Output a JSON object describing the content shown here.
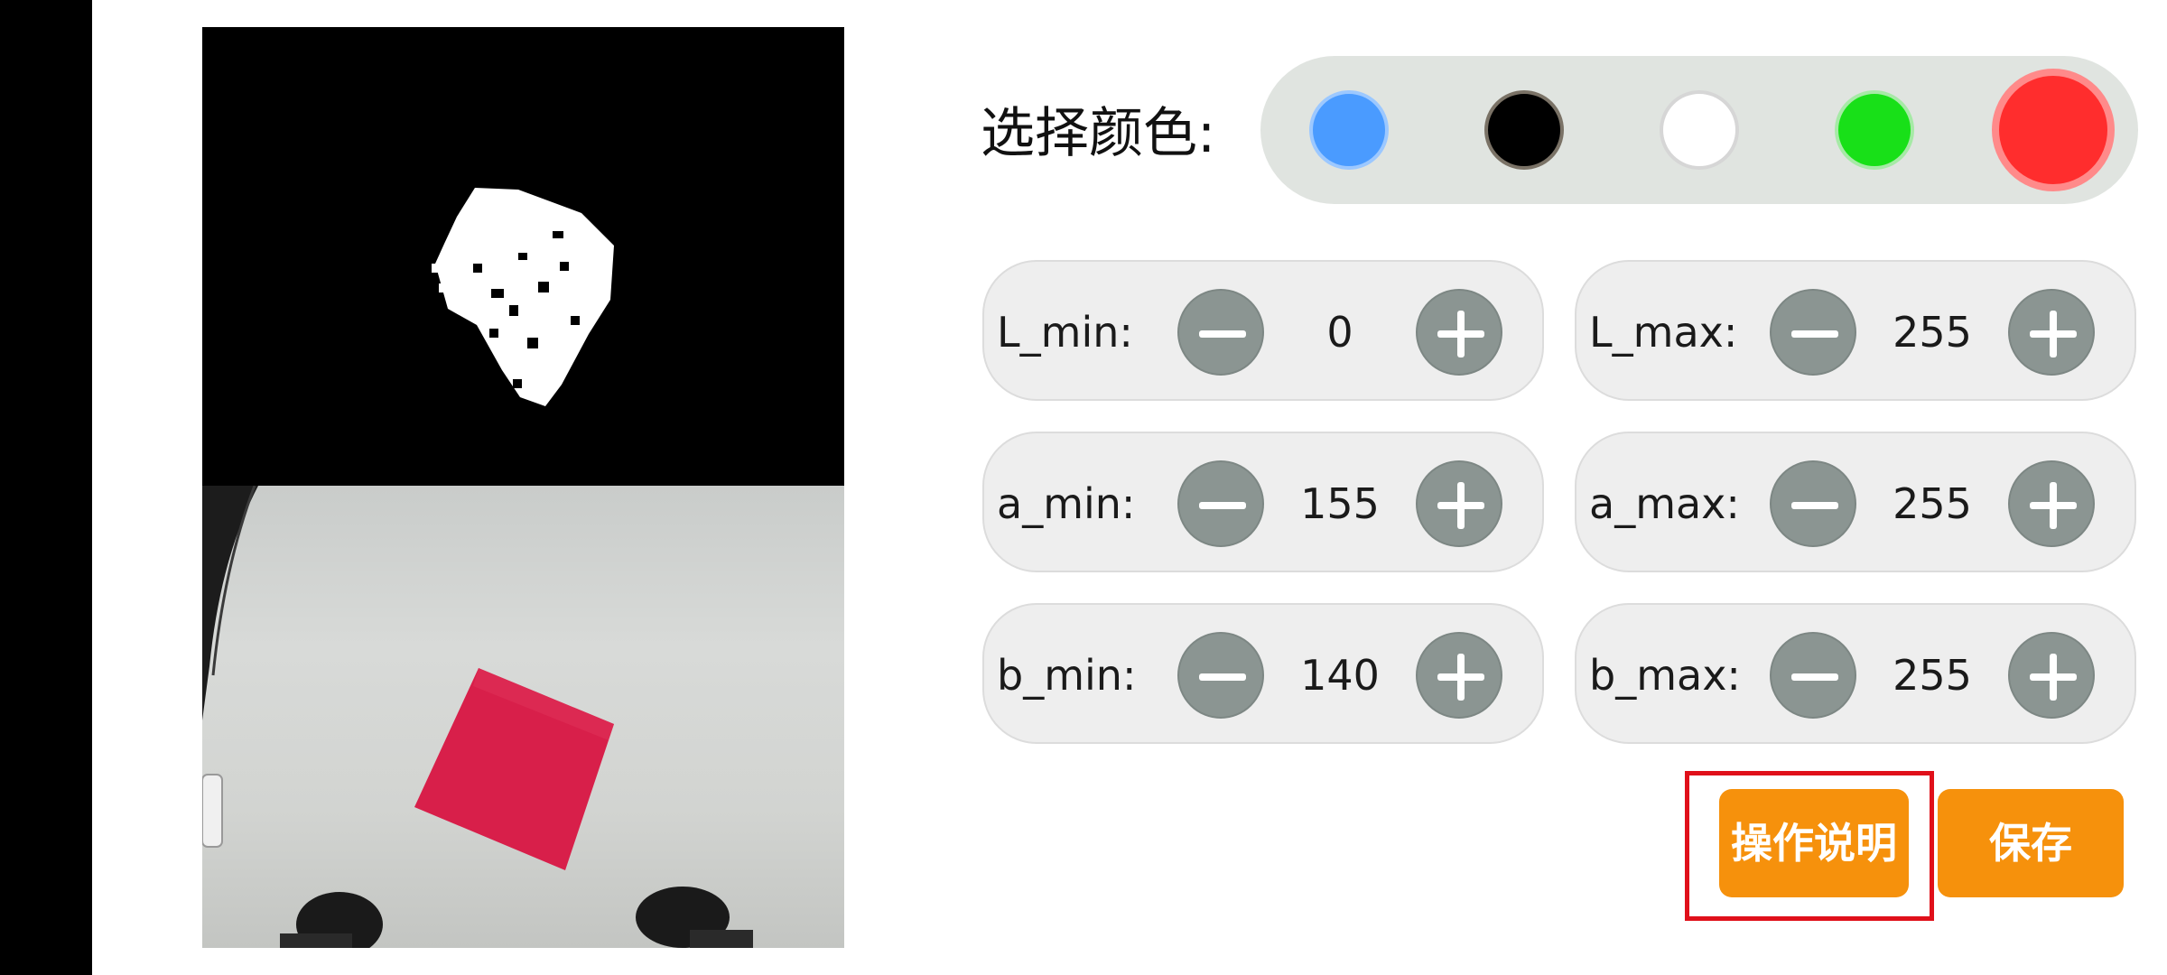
{
  "color_selector": {
    "label": "选择颜色:",
    "swatches": [
      {
        "name": "blue",
        "color": "#4a9bff",
        "selected": false
      },
      {
        "name": "black",
        "color": "#000000",
        "selected": false
      },
      {
        "name": "white",
        "color": "#ffffff",
        "selected": false
      },
      {
        "name": "green",
        "color": "#18e018",
        "selected": false
      },
      {
        "name": "red",
        "color": "#ff2d2d",
        "selected": true
      }
    ]
  },
  "params": {
    "l_min": {
      "label": "L_min:",
      "value": "0"
    },
    "l_max": {
      "label": "L_max:",
      "value": "255"
    },
    "a_min": {
      "label": "a_min:",
      "value": "155"
    },
    "a_max": {
      "label": "a_max:",
      "value": "255"
    },
    "b_min": {
      "label": "b_min:",
      "value": "140"
    },
    "b_max": {
      "label": "b_max:",
      "value": "255"
    }
  },
  "actions": {
    "instructions_label": "操作说明",
    "save_label": "保存"
  },
  "colors": {
    "accent_orange": "#f6910c",
    "stepper_gray": "#8b9592",
    "highlight_red": "#e0101a",
    "object_red": "#d81f4a"
  }
}
